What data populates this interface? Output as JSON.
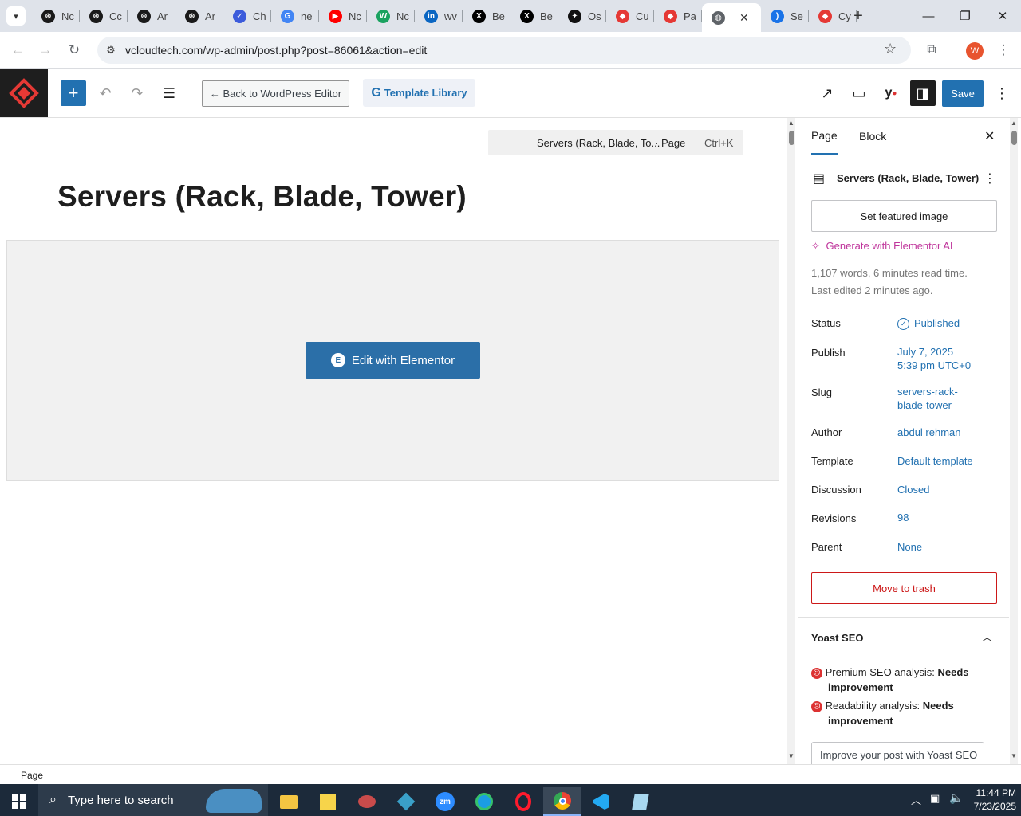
{
  "browser": {
    "tabs": [
      {
        "label": "Nc",
        "icon": "openai-icon",
        "color": "#1a1a1a"
      },
      {
        "label": "Cc",
        "icon": "openai-icon",
        "color": "#1a1a1a"
      },
      {
        "label": "Ar",
        "icon": "openai-icon",
        "color": "#1a1a1a"
      },
      {
        "label": "Ar",
        "icon": "openai-icon",
        "color": "#1a1a1a"
      },
      {
        "label": "Ch",
        "icon": "chat-icon",
        "color": "#3b5bdb"
      },
      {
        "label": "ne",
        "icon": "google-icon",
        "color": "#4285f4"
      },
      {
        "label": "Nc",
        "icon": "youtube-icon",
        "color": "#ff0000"
      },
      {
        "label": "Nc",
        "icon": "w-icon",
        "color": "#1aa260"
      },
      {
        "label": "wv",
        "icon": "linkedin-icon",
        "color": "#0a66c2"
      },
      {
        "label": "Be",
        "icon": "x-icon",
        "color": "#000000"
      },
      {
        "label": "Be",
        "icon": "x-icon",
        "color": "#000000"
      },
      {
        "label": "Os",
        "icon": "star-icon",
        "color": "#111111"
      },
      {
        "label": "Cu",
        "icon": "diamond-icon",
        "color": "#e53935"
      },
      {
        "label": "Pa",
        "icon": "diamond-icon",
        "color": "#e53935"
      },
      {
        "label": "",
        "icon": "globe-icon",
        "color": "#5f6368",
        "active": true
      },
      {
        "label": "Se",
        "icon": "paren-icon",
        "color": "#1a73e8"
      },
      {
        "label": "Cy",
        "icon": "diamond-icon",
        "color": "#e53935"
      }
    ],
    "new_tab": "+",
    "url": "vcloudtech.com/wp-admin/post.php?post=86061&action=edit",
    "profile_initial": "W"
  },
  "toolbar": {
    "add": "+",
    "back_label": "← Back to WordPress Editor",
    "template_label": "Template Library",
    "save_label": "Save"
  },
  "canvas": {
    "command_title": "Servers (Rack, Blade, To...",
    "command_type": "· Page",
    "command_shortcut": "Ctrl+K",
    "post_title": "Servers (Rack, Blade, Tower)",
    "elementor_button": "Edit with Elementor"
  },
  "sidebar": {
    "tab_page": "Page",
    "tab_block": "Block",
    "page_name": "Servers (Rack, Blade, Tower)",
    "featured_image": "Set featured image",
    "generate_ai": "Generate with Elementor AI",
    "stats_line1": "1,107 words, 6 minutes read time.",
    "stats_line2": "Last edited 2 minutes ago.",
    "fields": {
      "status_label": "Status",
      "status_value": "Published",
      "publish_label": "Publish",
      "publish_value1": "July 7, 2025",
      "publish_value2": "5:39 pm UTC+0",
      "slug_label": "Slug",
      "slug_value1": "servers-rack-",
      "slug_value2": "blade-tower",
      "author_label": "Author",
      "author_value": "abdul rehman",
      "template_label": "Template",
      "template_value": "Default template",
      "discussion_label": "Discussion",
      "discussion_value": "Closed",
      "revisions_label": "Revisions",
      "revisions_value": "98",
      "parent_label": "Parent",
      "parent_value": "None"
    },
    "trash": "Move to trash",
    "yoast_title": "Yoast SEO",
    "yoast_premium_label": "Premium SEO analysis: ",
    "yoast_premium_value": "Needs",
    "yoast_premium_value2": "improvement",
    "yoast_readability_label": "Readability analysis: ",
    "yoast_readability_value": "Needs",
    "yoast_readability_value2": "improvement",
    "yoast_improve": "Improve your post with Yoast SEO"
  },
  "statusbar": {
    "label": "Page"
  },
  "taskbar": {
    "search_placeholder": "Type here to search",
    "time": "11:44 PM",
    "date": "7/23/2025"
  },
  "colors": {
    "wp_blue": "#2271b1",
    "elementor_blue": "#2b6fa8",
    "danger": "#cc1818",
    "ai_pink": "#c0369c"
  }
}
